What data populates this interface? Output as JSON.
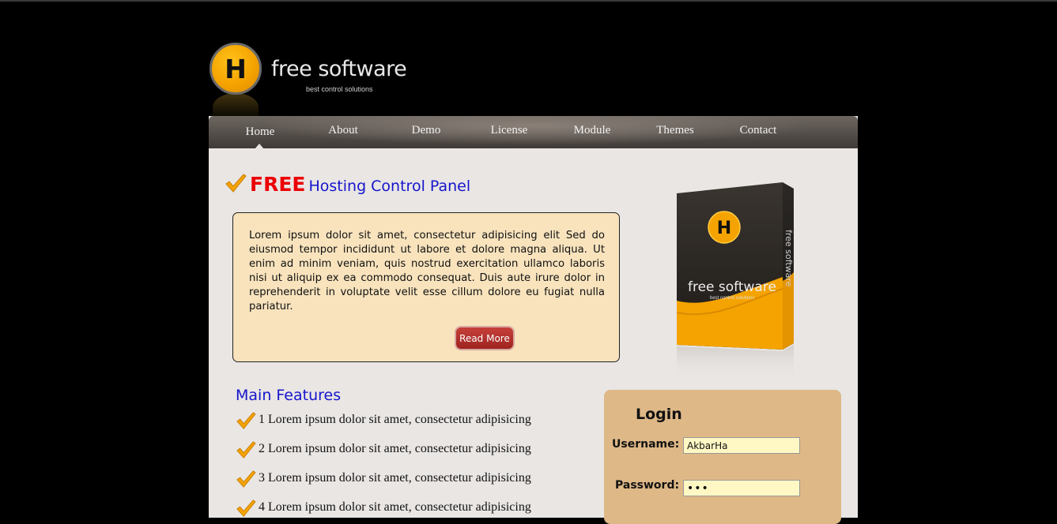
{
  "brand": {
    "logo_letter": "H",
    "title": "free software",
    "tagline": "best control solutions"
  },
  "nav": {
    "items": [
      "Home",
      "About",
      "Demo",
      "License",
      "Module",
      "Themes",
      "Contact"
    ],
    "active": "Home"
  },
  "hero": {
    "free": "FREE",
    "rest": "Hosting Control Panel",
    "text": "Lorem ipsum dolor sit amet, consectetur adipisicing elit Sed do eiusmod tempor incididunt ut labore et dolore magna aliqua. Ut enim ad minim veniam, quis nostrud exercitation ullamco laboris nisi ut aliquip ex ea commodo consequat. Duis aute irure dolor in reprehenderit in voluptate velit esse cillum dolore eu fugiat nulla pariatur.",
    "button": "Read More"
  },
  "product_box": {
    "logo_letter": "H",
    "title": "free software",
    "tagline": "best control solutions",
    "side_text": "free software"
  },
  "features": {
    "title": "Main Features",
    "items": [
      "1 Lorem ipsum dolor sit amet, consectetur adipisicing",
      "2 Lorem ipsum dolor sit amet, consectetur adipisicing",
      "3 Lorem ipsum dolor sit amet, consectetur adipisicing",
      "4 Lorem ipsum dolor sit amet, consectetur adipisicing"
    ]
  },
  "login": {
    "title": "Login",
    "username_label": "Username:",
    "username_value": "AkbarHa",
    "password_label": "Password:",
    "password_value": "•••"
  },
  "colors": {
    "accent_orange": "#f5a300",
    "free_red": "#ec0000",
    "link_blue": "#1515cc",
    "button_red": "#b0302b",
    "login_bg": "#deb887",
    "info_bg": "#f8e3bd"
  }
}
